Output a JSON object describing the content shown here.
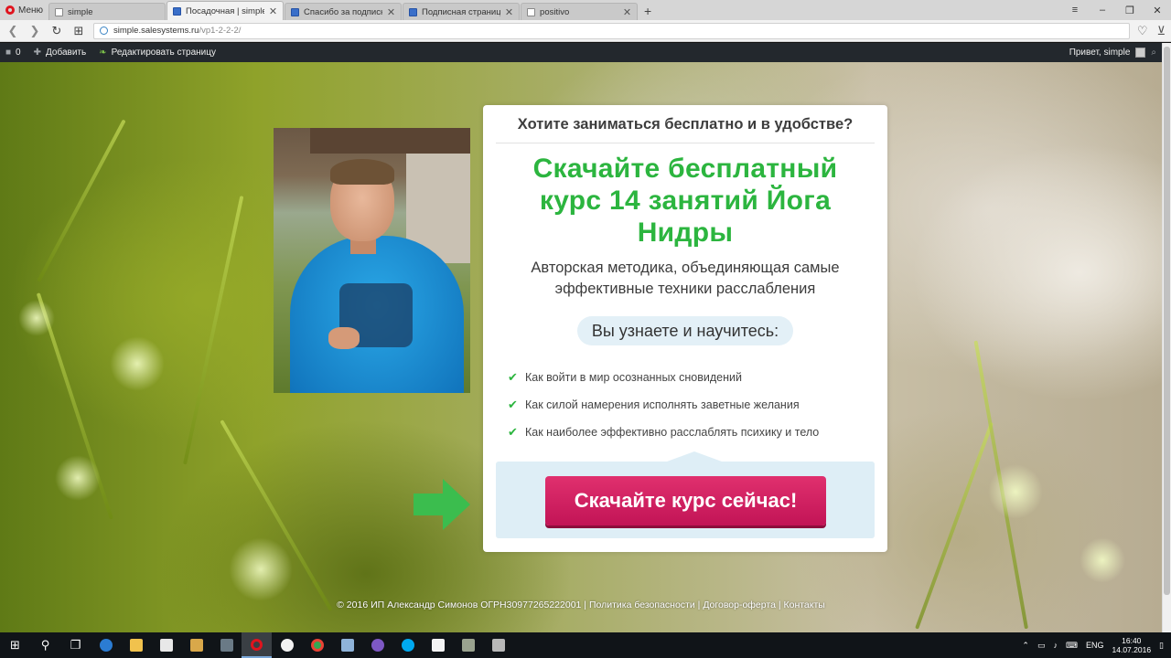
{
  "browser": {
    "menu_label": "Меню",
    "tabs": [
      {
        "title": "simple",
        "active": false,
        "favicon": "doc"
      },
      {
        "title": "Посадочная | simple",
        "active": true,
        "favicon": "blue"
      },
      {
        "title": "Спасибо за подписку! | si",
        "active": false,
        "favicon": "blue"
      },
      {
        "title": "Подписная страница | sim",
        "active": false,
        "favicon": "blue"
      },
      {
        "title": "positivo",
        "active": false,
        "favicon": "doc"
      }
    ],
    "url_host": "simple.salesystems.ru",
    "url_path": "/vp1-2-2-2/"
  },
  "wp_admin": {
    "comments_count": "0",
    "add_label": "Добавить",
    "edit_label": "Редактировать страницу",
    "greeting": "Привет, simple"
  },
  "card": {
    "kicker": "Хотите заниматься бесплатно и в удобстве?",
    "headline": "Скачайте бесплатный курс 14 занятий Йога Нидры",
    "subtitle": "Авторская методика, объединяющая самые эффективные техники расслабления",
    "pill": "Вы узнаете и научитесь:",
    "benefits": [
      "Как войти в мир осознанных сновидений",
      "Как силой намерения исполнять заветные желания",
      "Как наиболее эффективно расслаблять психику и тело"
    ],
    "cta_label": "Скачайте курс сейчас!"
  },
  "footer": {
    "copyright": "© 2016 ИП Александр Симонов  ОГРН30977265222001",
    "sep1": " | ",
    "privacy": "Политика безопасности",
    "sep2": " | ",
    "offer": "Договор-оферта",
    "sep3": " | ",
    "contacts": "Контакты"
  },
  "taskbar": {
    "lang": "ENG",
    "time": "16:40",
    "date": "14.07.2016"
  },
  "colors": {
    "accent_green": "#2cb53f",
    "cta_pink": "#d0205f",
    "pill_bg": "#e3f0f7"
  }
}
